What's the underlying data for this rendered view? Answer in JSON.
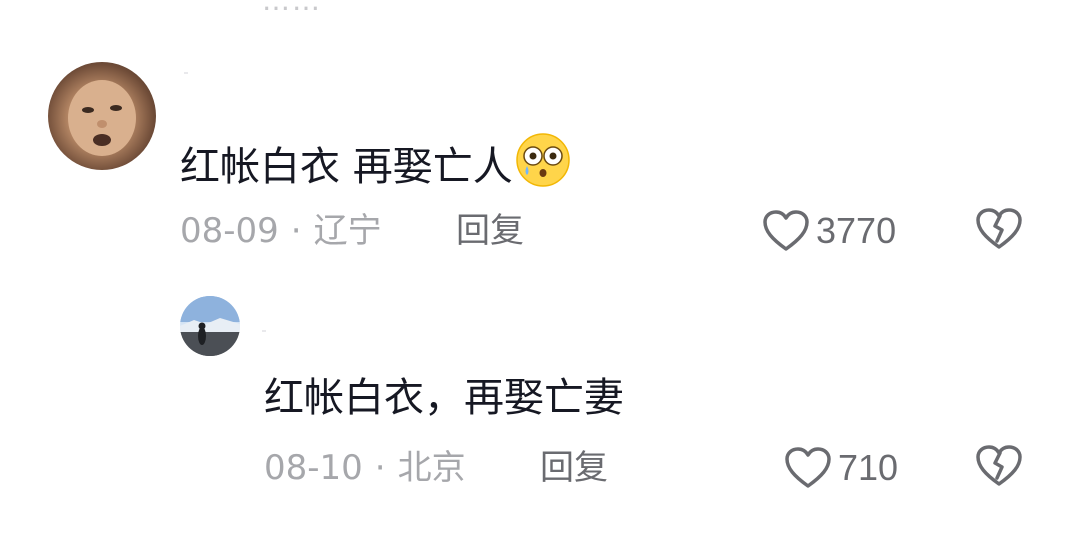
{
  "top_fragment": "……",
  "comments": [
    {
      "text": "红帐白衣 再娶亡人",
      "emoji": "shocked-tear-emoji",
      "date": "08-09",
      "location": "辽宁",
      "reply_label": "回复",
      "likes": "3770"
    },
    {
      "text": "红帐白衣，再娶亡妻",
      "date": "08-10",
      "location": "北京",
      "reply_label": "回复",
      "likes": "710"
    }
  ],
  "separator": "·",
  "colors": {
    "text": "#161823",
    "meta": "#a6a7ab",
    "action": "#6a6b70"
  }
}
